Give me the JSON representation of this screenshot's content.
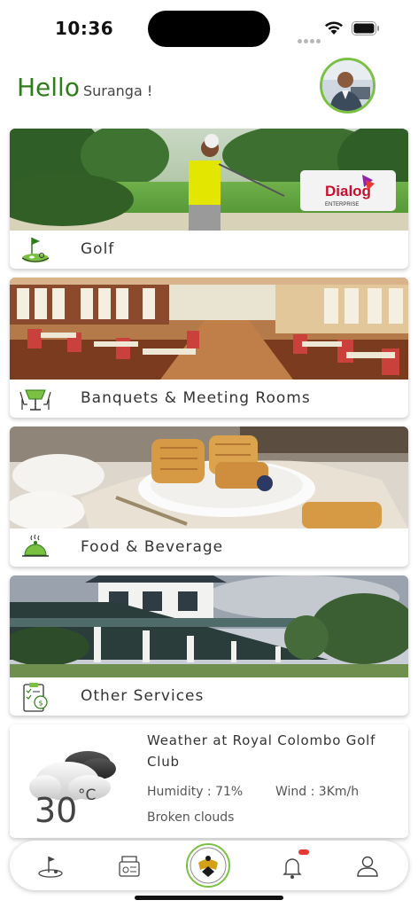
{
  "status": {
    "time": "10:36"
  },
  "header": {
    "hello": "Hello",
    "user_name": "Suranga !"
  },
  "cards": [
    {
      "label": "Golf",
      "icon": "golf-icon",
      "badge_brand": "Dialog",
      "badge_sub": "ENTERPRISE"
    },
    {
      "label": "Banquets & Meeting Rooms",
      "icon": "banquet-table-icon"
    },
    {
      "label": "Food & Beverage",
      "icon": "cloche-icon"
    },
    {
      "label": "Other Services",
      "icon": "services-clipboard-icon"
    }
  ],
  "weather": {
    "title": "Weather at Royal Colombo Golf Club",
    "temp": "30",
    "unit": "°C",
    "humidity": "Humidity : 71%",
    "wind": "Wind : 3Km/h",
    "description": "Broken clouds"
  },
  "tabbar": {
    "items": [
      "golf-tab-icon",
      "bookings-tab-icon",
      "club-logo-home",
      "notifications-bell-icon",
      "profile-icon"
    ],
    "notification_color": "#e53935"
  },
  "colors": {
    "accent": "#2e7d1a",
    "accent_light": "#7ac142"
  }
}
